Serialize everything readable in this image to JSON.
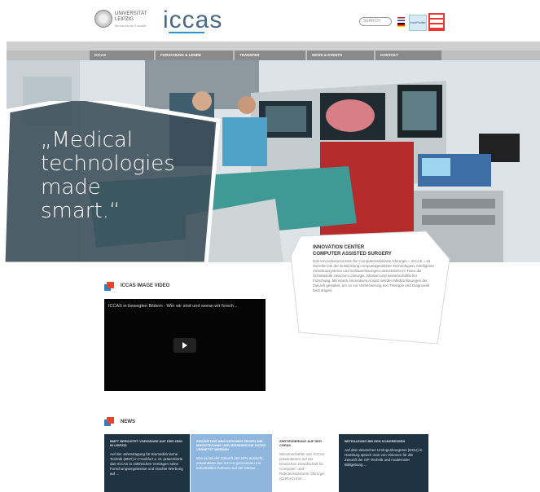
{
  "header": {
    "university_name": "UNIVERSITÄT LEIPZIG",
    "university_sub": "Medizinische Fakultät",
    "logo_text": "iccas",
    "search_placeholder": "SEARCH",
    "badge_text": "InnoProfile",
    "brand_color": "#3a8fd1"
  },
  "nav": {
    "items": [
      {
        "label": "ICCAS"
      },
      {
        "label": "FORSCHUNG & LEHRE"
      },
      {
        "label": "TRANSFER"
      },
      {
        "label": "NEWS & EVENTS"
      },
      {
        "label": "KONTAKT"
      }
    ]
  },
  "hero": {
    "quote_line1": "„Medical",
    "quote_line2": "technologies",
    "quote_line3": "made",
    "quote_line4": "smart.“"
  },
  "info": {
    "title_line1": "INNOVATION CENTER",
    "title_line2": "COMPUTER ASSISTED SURGERY",
    "text": "Das Innovationszentrum für Computerassistierte Chirurgie – ICCAS – ist Vorreiter bei der Entwicklung computergestützter Technologien. Intelligente Assistenzsysteme und Softwarelösungen unterstützen im Team die Schnittstelle zwischen Chirurgie, Kliniken und wissenschaftlicher Forschung. Mit einem innovativen Ansatz werden Medizinlösungen der Zukunft gestaltet, um so zur Verbesserung von Therapie und Diagnostik beizutragen."
  },
  "video": {
    "heading": "ICCAS IMAGE VIDEO",
    "title": "ICCAS in bewegten Bildern - Wer wir sind und woran wir forsch..."
  },
  "news": {
    "heading": "NEWS",
    "items": [
      {
        "title": "BMFT BERICHTET VORGÄNGE AUF DER ZBIO IN LEIPZIG",
        "text": "Auf der Jahrestagung für Biomedizinische Technik (BMT) in Frankfurt a. M. präsentierte das ICCAS in zahlreichen Vorträgen seine Forschungsergebnisse und machte Werbung auf ..."
      },
      {
        "title": "ZUKÜNFTIGE INNOVATIONEN ZEIGEN WIE MIKROTECHNIK UND MEDIZINISCHE DATEN VERNETZT WERDEN",
        "text": "Wie es bei der Zukunft des OPs aussieht, präsentierte das ICCAS gemeinsam mit industriellen Partnern auf der Messe ..."
      },
      {
        "title": "ZERTIFIZIERUNG AUF DER COPAS",
        "text": "Wissenschaftler des ICCAS präsentierten auf der Deutschen Gesellschaft für Computer- und Roboterassistierte Chirurgie (CURAC) ihre ..."
      },
      {
        "title": "BETEILIGUNG BEI DEN KONGRESSEN",
        "text": "Auf dem deutschen Urologenkongress (DGU) in Hamburg sprach man von Visionen für die Zukunft der OP-Technik und modernster Bildgebung ..."
      }
    ]
  },
  "colors": {
    "nav_item": "#8a8a8a",
    "news_dark": "#1f3342",
    "news_light": "#8fb7de",
    "icon_red": "#e5452f",
    "icon_blue": "#2d80c3"
  }
}
